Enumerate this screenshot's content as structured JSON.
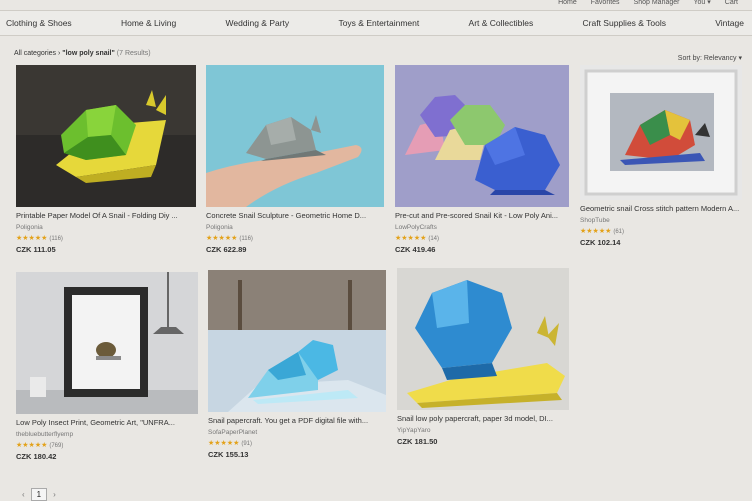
{
  "topbar": {
    "items": [
      "Home",
      "Favorites",
      "Shop Manager",
      "You ▾",
      "Cart"
    ]
  },
  "categories": [
    "Clothing & Shoes",
    "Home & Living",
    "Wedding & Party",
    "Toys & Entertainment",
    "Art & Collectibles",
    "Craft Supplies & Tools",
    "Vintage"
  ],
  "breadcrumb": {
    "root": "All categories",
    "sep": "›",
    "query": "\"low poly snail\"",
    "count": "(7 Results)"
  },
  "sort": {
    "label": "Sort by: Relevancy ▾"
  },
  "products": [
    {
      "title": "Printable Paper Model Of A Snail - Folding Diy ...",
      "shop": "Poligonia",
      "stars": "★★★★★",
      "reviews": "(116)",
      "price": "CZK 111.05"
    },
    {
      "title": "Concrete Snail Sculpture - Geometric Home D...",
      "shop": "Poligonia",
      "stars": "★★★★★",
      "reviews": "(116)",
      "price": "CZK 622.89"
    },
    {
      "title": "Pre-cut and Pre-scored Snail Kit - Low Poly Ani...",
      "shop": "LowPolyCrafts",
      "stars": "★★★★★",
      "reviews": "(14)",
      "price": "CZK 419.46"
    },
    {
      "title": "Geometric snail Cross stitch pattern Modern A...",
      "shop": "ShopTube",
      "stars": "★★★★★",
      "reviews": "(61)",
      "price": "CZK 102.14"
    },
    {
      "title": "Low Poly Insect Print, Geometric Art, \"UNFRA...",
      "shop": "thebluebutterflyemp",
      "stars": "★★★★★",
      "reviews": "(769)",
      "price": "CZK 180.42"
    },
    {
      "title": "Snail papercraft. You get a PDF digital file with...",
      "shop": "SofaPaperPlanet",
      "stars": "★★★★★",
      "reviews": "(91)",
      "price": "CZK 155.13"
    },
    {
      "title": "Snail low poly papercraft, paper 3d model, DI...",
      "shop": "YipYapYaro",
      "stars": "",
      "reviews": "",
      "price": "CZK 181.50"
    }
  ],
  "pager": {
    "prev": "‹",
    "current": "1",
    "next": "›"
  }
}
